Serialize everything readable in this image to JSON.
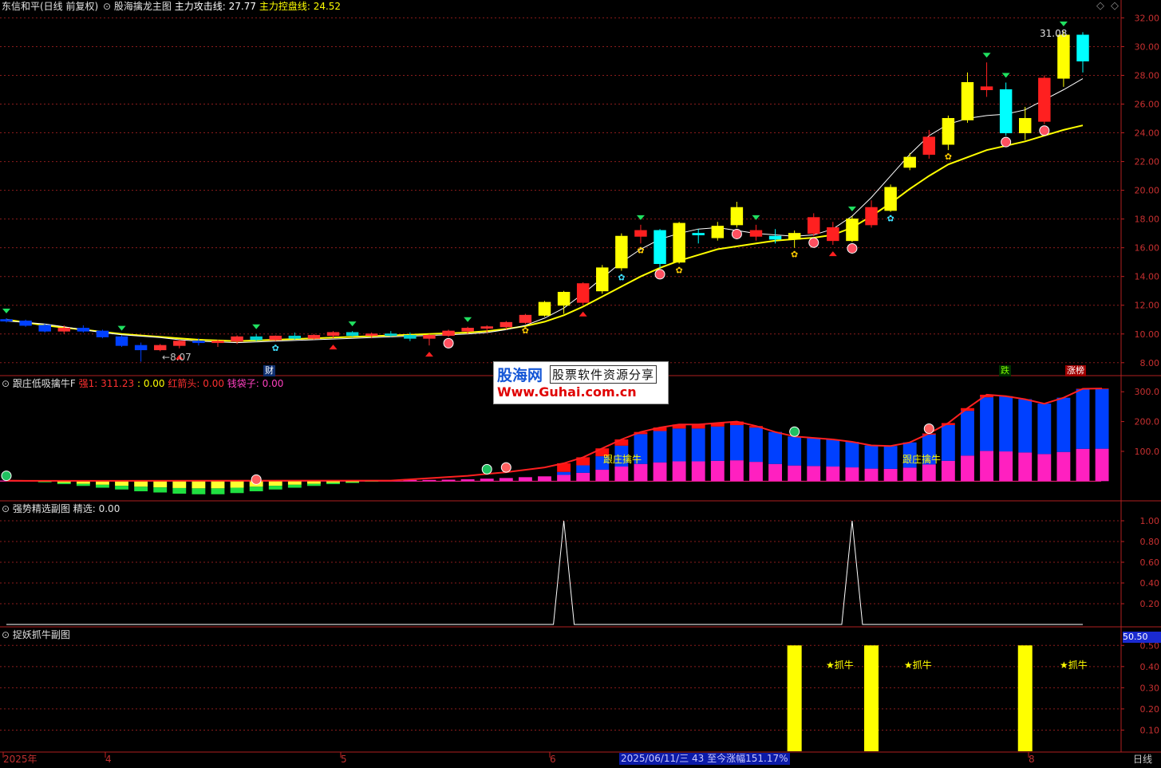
{
  "header": {
    "main_title": "东信和平(日线 前复权)",
    "main_indicator": "股海擒龙主图",
    "attack_label": "主力攻击线:",
    "attack_value": "27.77",
    "control_label": "主力控盘线:",
    "control_value": "24.52",
    "panel2_title": "跟庄低吸擒牛F",
    "panel2_strong_label": "强1:",
    "panel2_strong_value": "311.23",
    "panel2_colon_value": ": 0.00",
    "panel2_arrow_label": "红箭头:",
    "panel2_arrow_value": "0.00",
    "panel2_bag_label": "钱袋子:",
    "panel2_bag_value": "0.00",
    "panel3_title": "强势精选副图",
    "panel3_sel_label": "精选:",
    "panel3_sel_value": "0.00",
    "panel4_title": "捉妖抓牛副图"
  },
  "annotations": {
    "high_price": "31.08",
    "low_price": "8.07",
    "cai": "财",
    "die": "跌",
    "zhangbang": "涨榜",
    "gen_zhuang_1": "跟庄擒牛",
    "gen_zhuang_2": "跟庄擒牛",
    "zhua_niu": [
      "★抓牛",
      "★抓牛",
      "★抓牛"
    ],
    "scale_box": "50.50"
  },
  "watermark": {
    "site": "股海网",
    "slogan": "股票软件资源分享",
    "url": "Www.Guhai.com.cn"
  },
  "x_axis": {
    "labels": [
      "2025年",
      "4",
      "5",
      "6",
      "8"
    ],
    "period": "日线"
  },
  "status_bar": "2025/06/11/三 43 至今涨幅151.17%",
  "colors": {
    "up": "#ff2020",
    "down": "#00ffff",
    "signal_yellow": "#ffff00",
    "blue_candle": "#0040ff",
    "magenta": "#ff20c0",
    "grid": "#8b1c1c",
    "axis": "#c02020"
  },
  "chart_data": [
    {
      "type": "candlestick",
      "title": "东信和平(日线 前复权)",
      "y_ticks": [
        "32.00",
        "30.00",
        "28.00",
        "26.00",
        "24.00",
        "22.00",
        "20.00",
        "18.00",
        "16.00",
        "14.00",
        "12.00",
        "10.00",
        "8.00"
      ],
      "ylim": [
        7.6,
        32.8
      ],
      "series": [
        {
          "name": "主力攻击线",
          "last": 27.77
        },
        {
          "name": "主力控盘线",
          "last": 24.52
        }
      ],
      "ma_fast": [
        10.9,
        10.8,
        10.7,
        10.5,
        10.3,
        10.1,
        9.95,
        9.85,
        9.75,
        9.6,
        9.5,
        9.45,
        9.4,
        9.45,
        9.5,
        9.55,
        9.6,
        9.65,
        9.7,
        9.75,
        9.8,
        9.85,
        9.9,
        9.95,
        10.0,
        10.1,
        10.3,
        10.6,
        11.1,
        11.8,
        12.8,
        13.9,
        15.0,
        15.9,
        16.6,
        17.0,
        17.3,
        17.4,
        17.2,
        17.0,
        16.9,
        16.8,
        16.9,
        17.3,
        18.2,
        19.5,
        21.0,
        22.5,
        23.8,
        24.6,
        25.0,
        25.2,
        25.3,
        25.6,
        26.3,
        27.0,
        27.77
      ],
      "ma_slow": [
        11.0,
        10.8,
        10.6,
        10.45,
        10.3,
        10.15,
        10.0,
        9.9,
        9.8,
        9.7,
        9.6,
        9.55,
        9.5,
        9.55,
        9.6,
        9.65,
        9.7,
        9.75,
        9.8,
        9.85,
        9.9,
        9.95,
        10.0,
        10.05,
        10.1,
        10.2,
        10.35,
        10.55,
        10.85,
        11.3,
        11.9,
        12.6,
        13.3,
        14.0,
        14.6,
        15.1,
        15.5,
        15.9,
        16.1,
        16.3,
        16.5,
        16.6,
        16.7,
        16.9,
        17.4,
        18.2,
        19.1,
        20.1,
        21.0,
        21.8,
        22.3,
        22.8,
        23.1,
        23.4,
        23.8,
        24.2,
        24.52
      ],
      "candles_ohlc": [
        {
          "o": 11.0,
          "h": 11.1,
          "l": 10.8,
          "c": 10.9
        },
        {
          "o": 10.9,
          "h": 11.0,
          "l": 10.5,
          "c": 10.6
        },
        {
          "o": 10.6,
          "h": 10.7,
          "l": 10.1,
          "c": 10.2
        },
        {
          "o": 10.2,
          "h": 10.6,
          "l": 10.0,
          "c": 10.4
        },
        {
          "o": 10.4,
          "h": 10.6,
          "l": 10.1,
          "c": 10.2
        },
        {
          "o": 10.2,
          "h": 10.3,
          "l": 9.7,
          "c": 9.8
        },
        {
          "o": 9.8,
          "h": 9.9,
          "l": 9.1,
          "c": 9.2
        },
        {
          "o": 9.2,
          "h": 9.4,
          "l": 8.07,
          "c": 8.9
        },
        {
          "o": 8.9,
          "h": 9.3,
          "l": 8.8,
          "c": 9.2
        },
        {
          "o": 9.2,
          "h": 9.6,
          "l": 9.0,
          "c": 9.5
        },
        {
          "o": 9.5,
          "h": 9.7,
          "l": 9.2,
          "c": 9.4
        },
        {
          "o": 9.4,
          "h": 9.6,
          "l": 9.1,
          "c": 9.5
        },
        {
          "o": 9.5,
          "h": 9.9,
          "l": 9.3,
          "c": 9.8
        },
        {
          "o": 9.8,
          "h": 10.0,
          "l": 9.5,
          "c": 9.6
        },
        {
          "o": 9.6,
          "h": 9.9,
          "l": 9.5,
          "c": 9.85
        },
        {
          "o": 9.85,
          "h": 10.1,
          "l": 9.6,
          "c": 9.7
        },
        {
          "o": 9.7,
          "h": 10.0,
          "l": 9.6,
          "c": 9.9
        },
        {
          "o": 9.9,
          "h": 10.2,
          "l": 9.7,
          "c": 10.1
        },
        {
          "o": 10.1,
          "h": 10.2,
          "l": 9.8,
          "c": 9.9
        },
        {
          "o": 9.9,
          "h": 10.1,
          "l": 9.7,
          "c": 10.0
        },
        {
          "o": 10.0,
          "h": 10.2,
          "l": 9.8,
          "c": 9.9
        },
        {
          "o": 9.9,
          "h": 10.1,
          "l": 9.5,
          "c": 9.7
        },
        {
          "o": 9.7,
          "h": 10.0,
          "l": 9.2,
          "c": 9.9
        },
        {
          "o": 9.9,
          "h": 10.3,
          "l": 9.8,
          "c": 10.2
        },
        {
          "o": 10.2,
          "h": 10.5,
          "l": 10.0,
          "c": 10.4
        },
        {
          "o": 10.4,
          "h": 10.6,
          "l": 10.1,
          "c": 10.5
        },
        {
          "o": 10.5,
          "h": 10.9,
          "l": 10.3,
          "c": 10.8
        },
        {
          "o": 10.8,
          "h": 11.4,
          "l": 10.7,
          "c": 11.3
        },
        {
          "o": 11.3,
          "h": 12.3,
          "l": 11.2,
          "c": 12.2
        },
        {
          "o": 12.0,
          "h": 13.0,
          "l": 11.4,
          "c": 12.9
        },
        {
          "o": 12.2,
          "h": 13.6,
          "l": 12.0,
          "c": 13.5
        },
        {
          "o": 13.0,
          "h": 14.8,
          "l": 12.8,
          "c": 14.6
        },
        {
          "o": 14.6,
          "h": 17.0,
          "l": 14.4,
          "c": 16.8
        },
        {
          "o": 16.8,
          "h": 17.6,
          "l": 16.3,
          "c": 17.2
        },
        {
          "o": 17.2,
          "h": 17.3,
          "l": 14.6,
          "c": 14.9
        },
        {
          "o": 15.0,
          "h": 17.8,
          "l": 14.9,
          "c": 17.7
        },
        {
          "o": 17.0,
          "h": 17.3,
          "l": 16.3,
          "c": 16.9
        },
        {
          "o": 16.7,
          "h": 17.8,
          "l": 16.5,
          "c": 17.5
        },
        {
          "o": 17.6,
          "h": 19.2,
          "l": 17.4,
          "c": 18.8
        },
        {
          "o": 17.2,
          "h": 17.6,
          "l": 16.5,
          "c": 16.8
        },
        {
          "o": 16.8,
          "h": 17.3,
          "l": 16.3,
          "c": 16.6
        },
        {
          "o": 16.6,
          "h": 17.2,
          "l": 16.0,
          "c": 17.0
        },
        {
          "o": 17.0,
          "h": 18.4,
          "l": 16.8,
          "c": 18.1
        },
        {
          "o": 17.4,
          "h": 17.8,
          "l": 16.2,
          "c": 16.5
        },
        {
          "o": 16.5,
          "h": 18.2,
          "l": 16.4,
          "c": 18.0
        },
        {
          "o": 17.6,
          "h": 19.3,
          "l": 17.4,
          "c": 18.8
        },
        {
          "o": 18.6,
          "h": 20.4,
          "l": 18.5,
          "c": 20.2
        },
        {
          "o": 21.6,
          "h": 22.6,
          "l": 21.4,
          "c": 22.3
        },
        {
          "o": 22.5,
          "h": 24.2,
          "l": 22.2,
          "c": 23.7
        },
        {
          "o": 23.2,
          "h": 25.2,
          "l": 22.8,
          "c": 25.0
        },
        {
          "o": 24.9,
          "h": 28.2,
          "l": 24.7,
          "c": 27.5
        },
        {
          "o": 27.2,
          "h": 28.9,
          "l": 26.5,
          "c": 27.0
        },
        {
          "o": 27.0,
          "h": 27.5,
          "l": 23.8,
          "c": 24.0
        },
        {
          "o": 24.0,
          "h": 25.8,
          "l": 23.5,
          "c": 25.0
        },
        {
          "o": 24.8,
          "h": 28.0,
          "l": 24.6,
          "c": 27.8
        },
        {
          "o": 27.8,
          "h": 31.08,
          "l": 27.2,
          "c": 30.8
        },
        {
          "o": 30.8,
          "h": 31.0,
          "l": 28.2,
          "c": 29.0
        }
      ]
    },
    {
      "type": "bar",
      "title": "跟庄低吸擒牛F",
      "y_ticks": [
        "300.0",
        "200.0",
        "100.0"
      ],
      "ylim": [
        -50,
        330
      ],
      "series": [
        {
          "name": "强1",
          "last": 311.23
        },
        {
          "name": "红箭头",
          "last": 0.0
        },
        {
          "name": "钱袋子",
          "last": 0.0
        }
      ],
      "total": [
        2,
        1,
        -4,
        -10,
        -16,
        -22,
        -28,
        -34,
        -38,
        -42,
        -44,
        -44,
        -40,
        -34,
        -28,
        -22,
        -16,
        -10,
        -6,
        -2,
        2,
        6,
        10,
        14,
        18,
        24,
        30,
        38,
        46,
        60,
        80,
        110,
        140,
        165,
        180,
        190,
        190,
        195,
        200,
        185,
        165,
        150,
        145,
        140,
        132,
        120,
        118,
        130,
        160,
        195,
        245,
        290,
        285,
        275,
        260,
        280,
        310,
        311
      ],
      "blue_part": [
        0,
        0,
        0,
        0,
        0,
        0,
        0,
        0,
        0,
        0,
        0,
        0,
        0,
        0,
        0,
        0,
        0,
        0,
        0,
        0,
        0,
        0,
        0,
        0,
        0,
        0,
        0,
        0,
        0,
        10,
        25,
        45,
        70,
        100,
        105,
        110,
        110,
        115,
        118,
        115,
        110,
        100,
        95,
        92,
        88,
        80,
        78,
        85,
        100,
        120,
        150,
        180,
        190,
        185,
        180,
        190,
        200,
        200
      ]
    },
    {
      "type": "line",
      "title": "强势精选副图",
      "y_ticks": [
        "1.00",
        "0.80",
        "0.60",
        "0.40",
        "0.20"
      ],
      "ylim": [
        0,
        1.1
      ],
      "series": [
        {
          "name": "精选",
          "last": 0.0
        }
      ],
      "spikes_at_index": [
        29,
        44
      ]
    },
    {
      "type": "bar",
      "title": "捉妖抓牛副图",
      "y_ticks": [
        "0.50",
        "0.40",
        "0.30",
        "0.20",
        "0.10"
      ],
      "ylim": [
        0,
        0.55
      ],
      "series": [
        {
          "name": "抓牛",
          "bars_at_index": [
            41,
            45,
            53
          ],
          "value": 0.5
        }
      ]
    }
  ]
}
